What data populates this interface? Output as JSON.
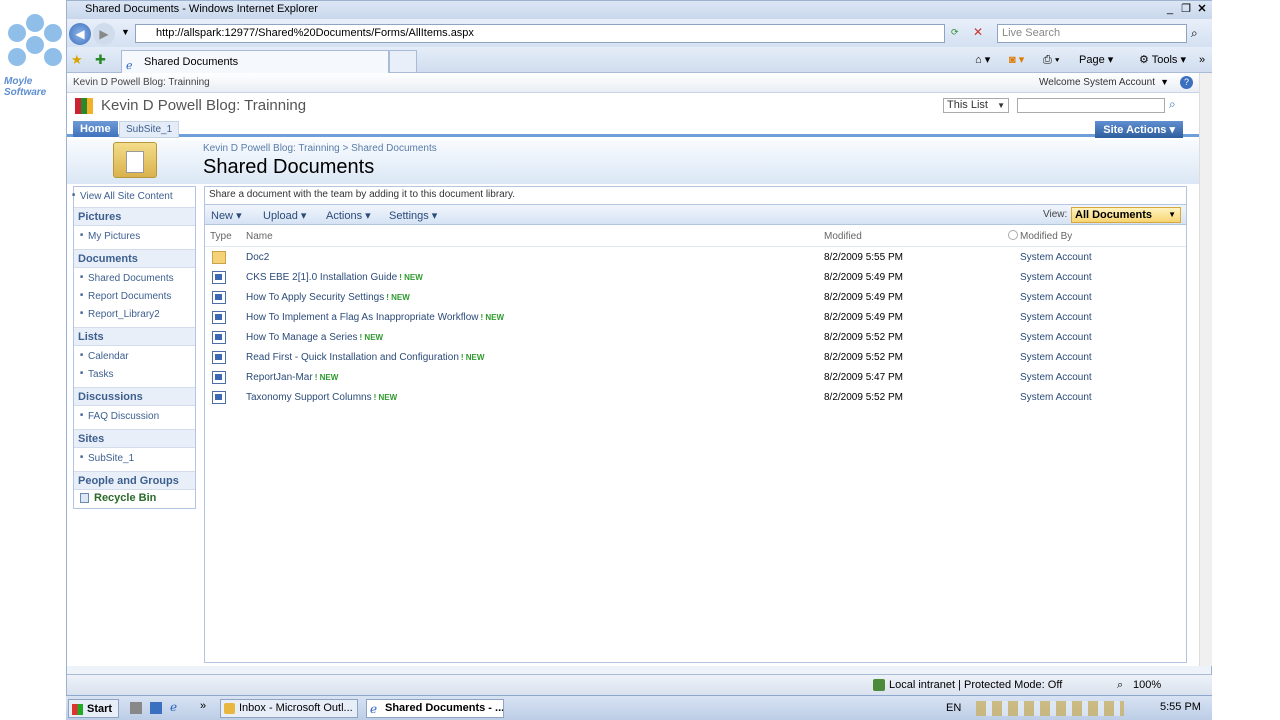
{
  "window": {
    "title": "Shared Documents - Windows Internet Explorer"
  },
  "browser": {
    "url": "http://allspark:12977/Shared%20Documents/Forms/AllItems.aspx",
    "search_placeholder": "Live Search",
    "tab_label": "Shared Documents",
    "page_menu": "Page",
    "tools_menu": "Tools"
  },
  "logo_text": "Moyle Software",
  "sp": {
    "top_crumb": "Kevin D Powell Blog: Trainning",
    "welcome": "Welcome System Account",
    "site_title": "Kevin D Powell Blog: Trainning",
    "scope": "This List",
    "nav_home": "Home",
    "nav_subsite": "SubSite_1",
    "site_actions": "Site Actions",
    "breadcrumb": "Kevin D Powell Blog: Trainning > Shared Documents",
    "page_title": "Shared Documents",
    "description": "Share a document with the team by adding it to this document library.",
    "toolbar": {
      "new": "New",
      "upload": "Upload",
      "actions": "Actions",
      "settings": "Settings",
      "view_label": "View:",
      "view_value": "All Documents"
    },
    "columns": {
      "type": "Type",
      "name": "Name",
      "modified": "Modified",
      "modified_by": "Modified By"
    },
    "quicklaunch": {
      "view_all": "View All Site Content",
      "pictures": "Pictures",
      "my_pictures": "My Pictures",
      "documents": "Documents",
      "shared_documents": "Shared Documents",
      "report_documents": "Report Documents",
      "report_library2": "Report_Library2",
      "lists": "Lists",
      "calendar": "Calendar",
      "tasks": "Tasks",
      "discussions": "Discussions",
      "faq": "FAQ Discussion",
      "sites": "Sites",
      "subsite": "SubSite_1",
      "people": "People and Groups",
      "recycle": "Recycle Bin"
    },
    "rows": [
      {
        "type": "folder",
        "name": "Doc2",
        "new": "",
        "modified": "8/2/2009 5:55 PM",
        "by": "System Account"
      },
      {
        "type": "doc",
        "name": "CKS EBE 2[1].0 Installation Guide",
        "new": "! NEW",
        "modified": "8/2/2009 5:49 PM",
        "by": "System Account"
      },
      {
        "type": "doc",
        "name": "How To Apply Security Settings",
        "new": "! NEW",
        "modified": "8/2/2009 5:49 PM",
        "by": "System Account"
      },
      {
        "type": "doc",
        "name": "How To Implement a Flag As Inappropriate Workflow",
        "new": "! NEW",
        "modified": "8/2/2009 5:49 PM",
        "by": "System Account"
      },
      {
        "type": "doc",
        "name": "How To Manage a Series",
        "new": "! NEW",
        "modified": "8/2/2009 5:52 PM",
        "by": "System Account"
      },
      {
        "type": "doc",
        "name": "Read First - Quick Installation and Configuration",
        "new": "! NEW",
        "modified": "8/2/2009 5:52 PM",
        "by": "System Account"
      },
      {
        "type": "doc",
        "name": "ReportJan-Mar",
        "new": "! NEW",
        "modified": "8/2/2009 5:47 PM",
        "by": "System Account"
      },
      {
        "type": "doc",
        "name": "Taxonomy Support Columns",
        "new": "! NEW",
        "modified": "8/2/2009 5:52 PM",
        "by": "System Account"
      }
    ]
  },
  "status": {
    "zone": "Local intranet | Protected Mode: Off",
    "zoom": "100%"
  },
  "taskbar": {
    "start": "Start",
    "task1": "Inbox - Microsoft Outl...",
    "task2": "Shared Documents - ...",
    "lang": "EN",
    "clock": "5:55 PM"
  }
}
